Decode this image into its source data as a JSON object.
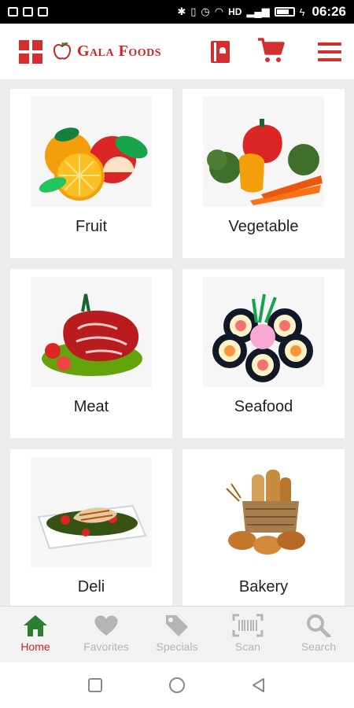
{
  "status_bar": {
    "network_label": "HD",
    "time": "06:26"
  },
  "app_bar": {
    "brand": "Gala Foods",
    "brand_color": "#c62828",
    "icons": [
      "grid-menu-icon",
      "apple-logo-icon",
      "recipe-card-icon",
      "cart-icon",
      "hamburger-menu-icon"
    ]
  },
  "categories": [
    {
      "label": "Fruit",
      "image": "fruit-image"
    },
    {
      "label": "Vegetable",
      "image": "vegetable-image"
    },
    {
      "label": "Meat",
      "image": "meat-image"
    },
    {
      "label": "Seafood",
      "image": "seafood-image"
    },
    {
      "label": "Deli",
      "image": "deli-image"
    },
    {
      "label": "Bakery",
      "image": "bakery-image"
    }
  ],
  "bottom_nav": {
    "active_color": "#2e7d32",
    "items": [
      {
        "label": "Home",
        "icon": "home-icon",
        "active": true
      },
      {
        "label": "Favorites",
        "icon": "heart-icon",
        "active": false
      },
      {
        "label": "Specials",
        "icon": "tag-icon",
        "active": false
      },
      {
        "label": "Scan",
        "icon": "barcode-icon",
        "active": false
      },
      {
        "label": "Search",
        "icon": "search-icon",
        "active": false
      }
    ]
  },
  "system_nav": {
    "icons": [
      "recents-icon",
      "home-circle-icon",
      "back-icon"
    ]
  }
}
